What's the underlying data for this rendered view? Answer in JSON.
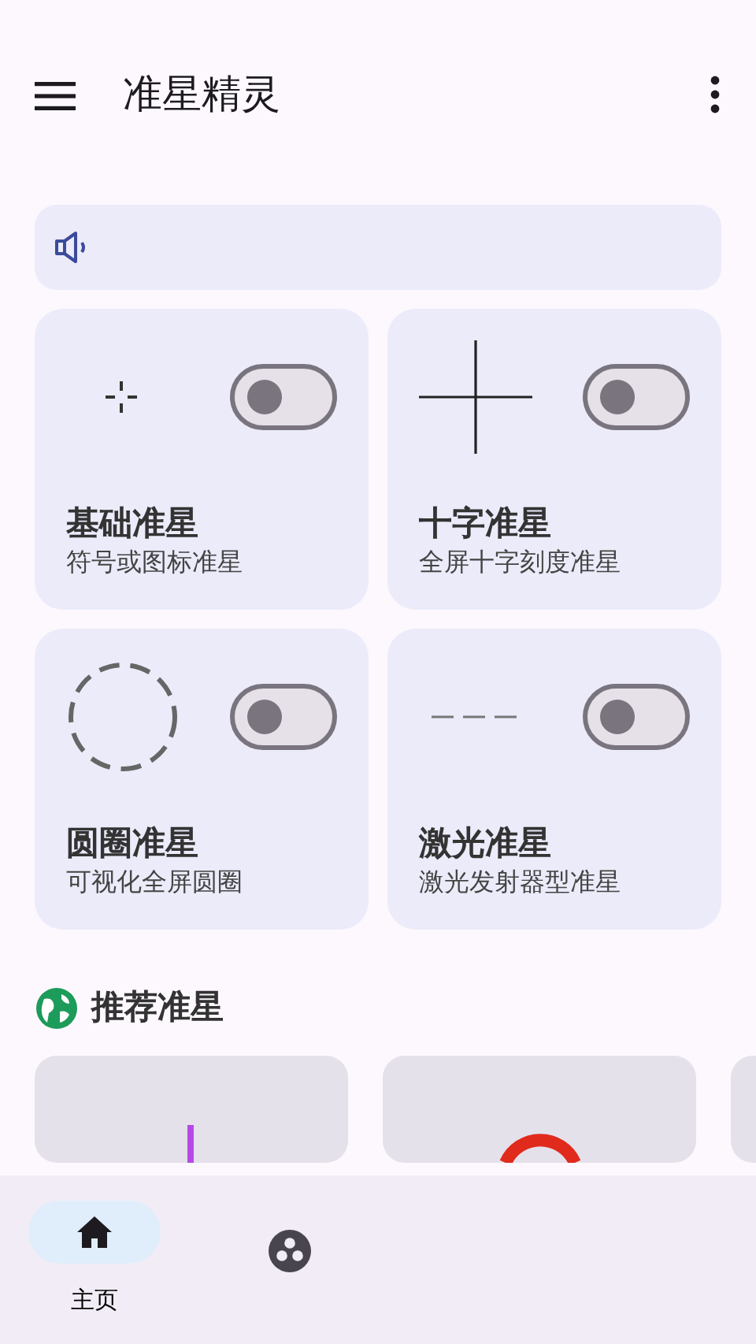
{
  "app_bar": {
    "title": "准星精灵"
  },
  "crosshairs": [
    {
      "kind": "dot",
      "title": "基础准星",
      "subtitle": "符号或图标准星",
      "on": false
    },
    {
      "kind": "cross",
      "title": "十字准星",
      "subtitle": "全屏十字刻度准星",
      "on": false
    },
    {
      "kind": "circle",
      "title": "圆圈准星",
      "subtitle": "可视化全屏圆圈",
      "on": false
    },
    {
      "kind": "laser",
      "title": "激光准星",
      "subtitle": "激光发射器型准星",
      "on": false
    }
  ],
  "recommended": {
    "title": "推荐准星",
    "items": [
      {
        "kind": "line",
        "color": "#b44ae6"
      },
      {
        "kind": "ring",
        "color": "#e02a1c"
      },
      {
        "kind": "blank",
        "color": "#e5e1ea"
      }
    ]
  },
  "bottom_nav": [
    {
      "kind": "home",
      "label": "主页",
      "selected": true
    },
    {
      "kind": "dots",
      "selected": false
    }
  ]
}
